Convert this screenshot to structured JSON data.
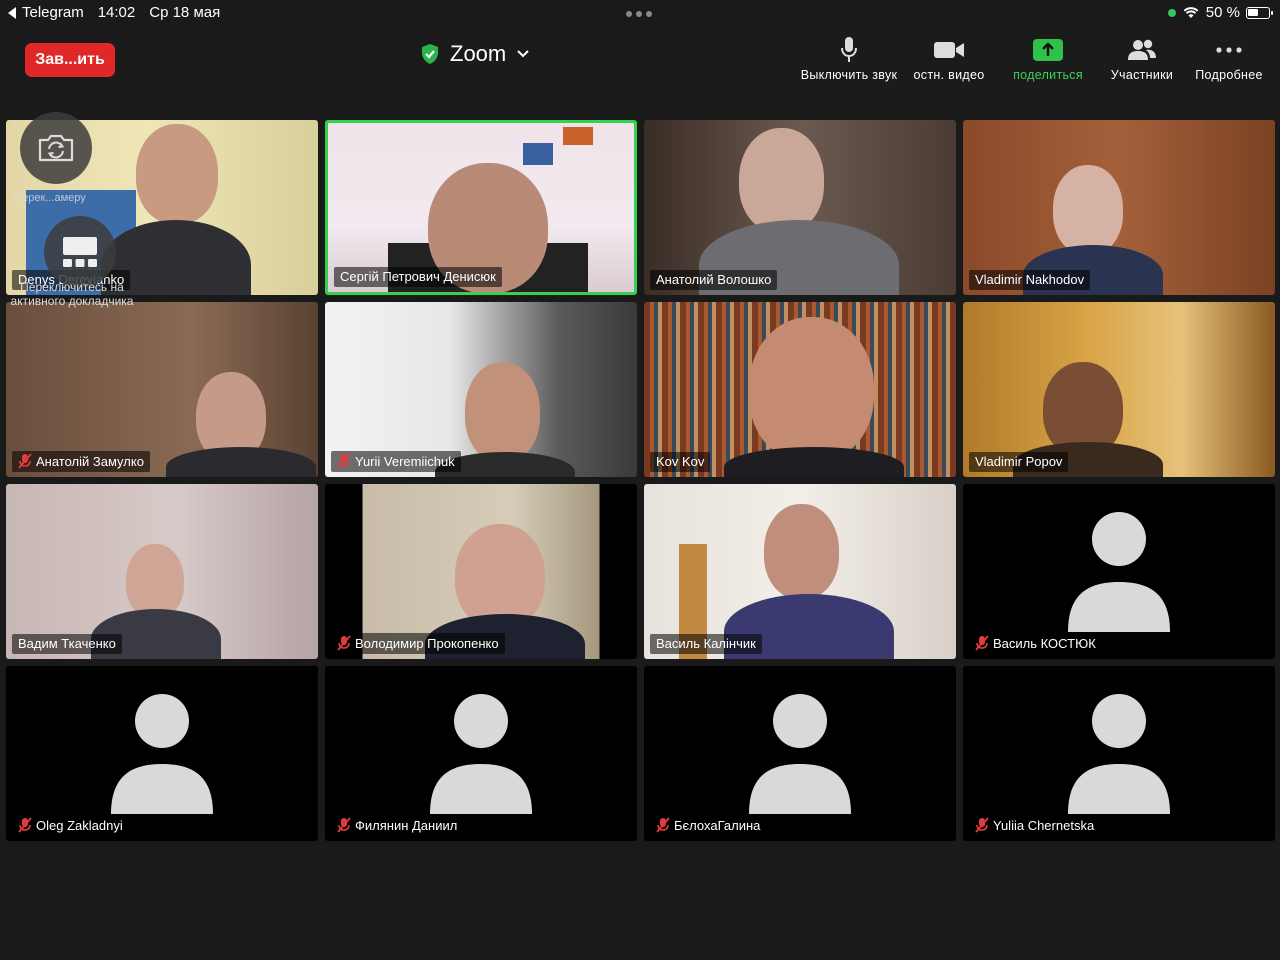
{
  "status_bar": {
    "back_app": "Telegram",
    "time": "14:02",
    "date": "Ср 18 мая",
    "battery": "50 %"
  },
  "toolbar": {
    "end_label": "Зав...ить",
    "title": "Zoom",
    "mute_label": "Выключить звук",
    "video_label": "остн. видео",
    "share_label": "поделиться",
    "participants_label": "Участники",
    "more_label": "Подробнее"
  },
  "overlays": {
    "switch_camera_label": "Перек...амеру",
    "switch_view_label": "Переключитесь на активного докладчика"
  },
  "colors": {
    "end_button": "#e02828",
    "share_accent": "#3fd05a",
    "active_speaker_border": "#35d14d",
    "muted_icon": "#e33b3b"
  },
  "participants": [
    {
      "name": "Denys Derevianko"
    },
    {
      "name": "Сергій Петрович Денисюк"
    },
    {
      "name": "Анатолий Волошко"
    },
    {
      "name": "Vladimir Nakhodov"
    },
    {
      "name": "Анатолій Замулко"
    },
    {
      "name": "Yurii Veremiichuk"
    },
    {
      "name": "Kov Kov"
    },
    {
      "name": "Vladimir Popov"
    },
    {
      "name": "Вадим Ткаченко"
    },
    {
      "name": "Володимир Прокопенко"
    },
    {
      "name": "Василь Калінчик"
    },
    {
      "name": "Василь КОСТЮК"
    },
    {
      "name": "Oleg Zakladnyi"
    },
    {
      "name": "Филянин Даниил"
    },
    {
      "name": "БєлохаГалина"
    },
    {
      "name": "Yuliia Chernetska"
    }
  ]
}
